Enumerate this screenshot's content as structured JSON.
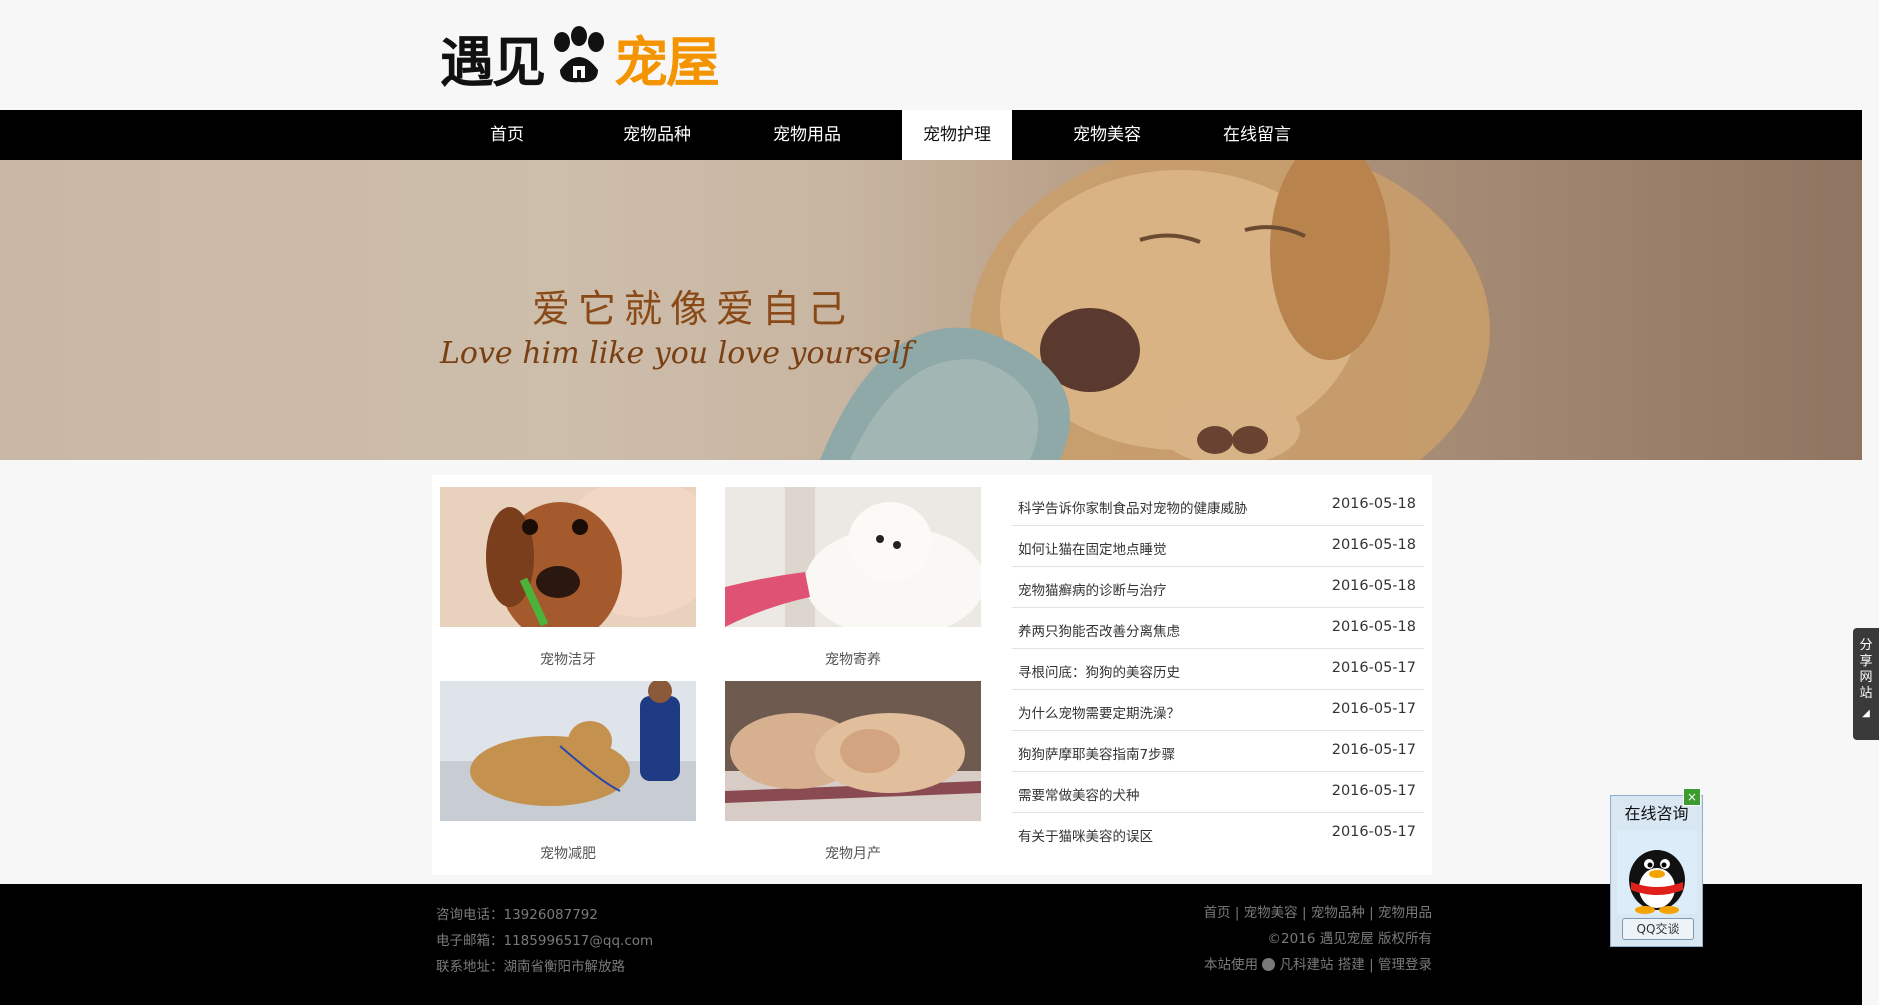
{
  "header": {
    "logo_part1": "遇见",
    "logo_part2": "宠屋"
  },
  "nav": {
    "items": [
      {
        "label": "首页"
      },
      {
        "label": "宠物品种"
      },
      {
        "label": "宠物用品"
      },
      {
        "label": "宠物护理",
        "active": true
      },
      {
        "label": "宠物美容"
      },
      {
        "label": "在线留言"
      }
    ]
  },
  "banner": {
    "title_cn": "爱它就像爱自己",
    "title_en": "Love him like you love yourself"
  },
  "gallery": [
    {
      "caption": "宠物洁牙"
    },
    {
      "caption": "宠物寄养"
    },
    {
      "caption": "宠物减肥"
    },
    {
      "caption": "宠物月产"
    }
  ],
  "news": [
    {
      "title": "科学告诉你家制食品对宠物的健康威胁",
      "date": "2016-05-18"
    },
    {
      "title": "如何让猫在固定地点睡觉",
      "date": "2016-05-18"
    },
    {
      "title": "宠物猫癣病的诊断与治疗",
      "date": "2016-05-18"
    },
    {
      "title": "养两只狗能否改善分离焦虑",
      "date": "2016-05-18"
    },
    {
      "title": "寻根问底：狗狗的美容历史",
      "date": "2016-05-17"
    },
    {
      "title": "为什么宠物需要定期洗澡？",
      "date": "2016-05-17"
    },
    {
      "title": "狗狗萨摩耶美容指南7步骤",
      "date": "2016-05-17"
    },
    {
      "title": "需要常做美容的犬种",
      "date": "2016-05-17"
    },
    {
      "title": "有关于猫咪美容的误区",
      "date": "2016-05-17"
    }
  ],
  "footer": {
    "phone": "咨询电话：13926087792",
    "email": "电子邮箱：1185996517@qq.com",
    "address": "联系地址：湖南省衡阳市解放路",
    "links": [
      "首页",
      "宠物美容",
      "宠物品种",
      "宠物用品"
    ],
    "separator": "|",
    "copyright": "©2016 遇见宠屋 版权所有",
    "powered_prefix": "本站使用",
    "powered_brand": "凡科建站",
    "powered_suffix": "搭建",
    "admin_login": "管理登录"
  },
  "share": {
    "label": "分享网站"
  },
  "qq": {
    "title": "在线咨询",
    "button": "QQ交谈",
    "close": "×"
  },
  "colors": {
    "nav_bg": "#000000",
    "logo_accent": "#f39400",
    "banner_text": "#8a4a18",
    "page_bg": "#f7f7f7"
  }
}
